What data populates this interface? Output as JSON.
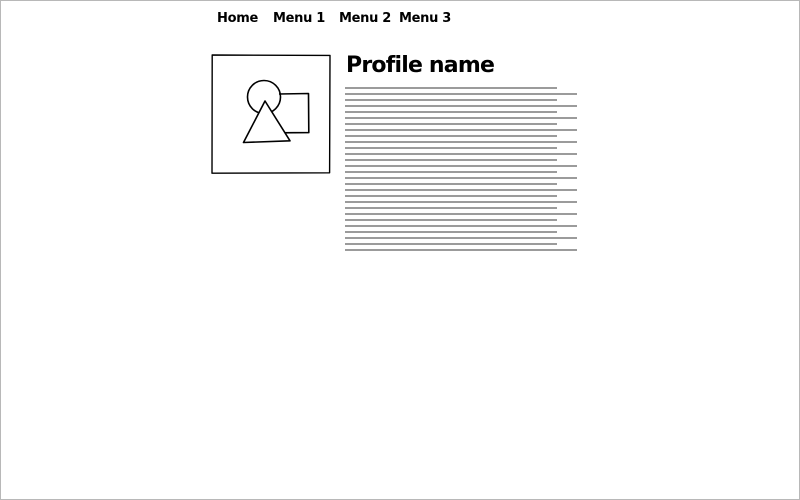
{
  "nav": {
    "items": [
      {
        "label": "Home"
      },
      {
        "label": "Menu 1"
      },
      {
        "label": "Menu 2"
      },
      {
        "label": "Menu 3"
      }
    ]
  },
  "profile": {
    "name": "Profile name",
    "image_icon": "image-placeholder-icon",
    "text_placeholder_icon": "text-block-placeholder"
  },
  "colors": {
    "border": "#b8b8b8",
    "ink": "#000000",
    "text_line": "#7a7a7a"
  }
}
